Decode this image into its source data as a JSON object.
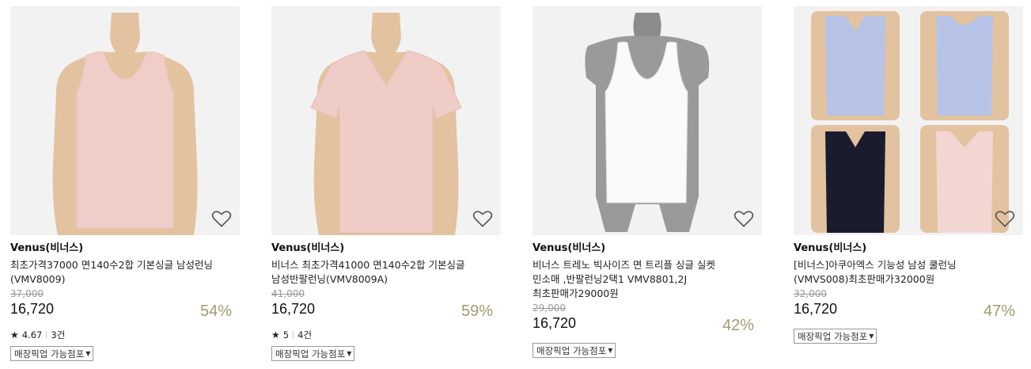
{
  "products": [
    {
      "brand": "Venus(비너스)",
      "title": "최초가격37000 면140수2합 기본싱글 남성런닝(VMV8009)",
      "original_price": "37,000",
      "price": "16,720",
      "discount": "54%",
      "rating": "4.67",
      "review_count": "3건",
      "pickup_label": "매장픽업 가능점포"
    },
    {
      "brand": "Venus(비너스)",
      "title": "비너스 최초가격41000 면140수2합 기본싱글 남성반팔런닝(VMV8009A)",
      "original_price": "41,000",
      "price": "16,720",
      "discount": "59%",
      "rating": "5",
      "review_count": "4건",
      "pickup_label": "매장픽업 가능점포"
    },
    {
      "brand": "Venus(비너스)",
      "title": "비너스 트레노 빅사이즈 면 트리플 싱글 실켓 민소매 ,반팔런닝2택1 VMV8801,2J 최초판매가29000원",
      "original_price": "29,000",
      "price": "16,720",
      "discount": "42%",
      "pickup_label": "매장픽업 가능점포"
    },
    {
      "brand": "Venus(비너스)",
      "title": "[비너스]아쿠아엑스 기능성 남성 쿨런닝(VMVS008)최초판매가32000원",
      "original_price": "32,000",
      "price": "16,720",
      "discount": "47%",
      "pickup_label": "매장픽업 가능점포"
    }
  ],
  "icons": {
    "wishlist": "heart-outline-icon",
    "rating": "star-icon",
    "dropdown": "caret-down-icon"
  },
  "colors": {
    "discount": "#a39a6f",
    "price": "#111111",
    "original_price": "#999999",
    "thumb_background": "#f2f2f2"
  }
}
